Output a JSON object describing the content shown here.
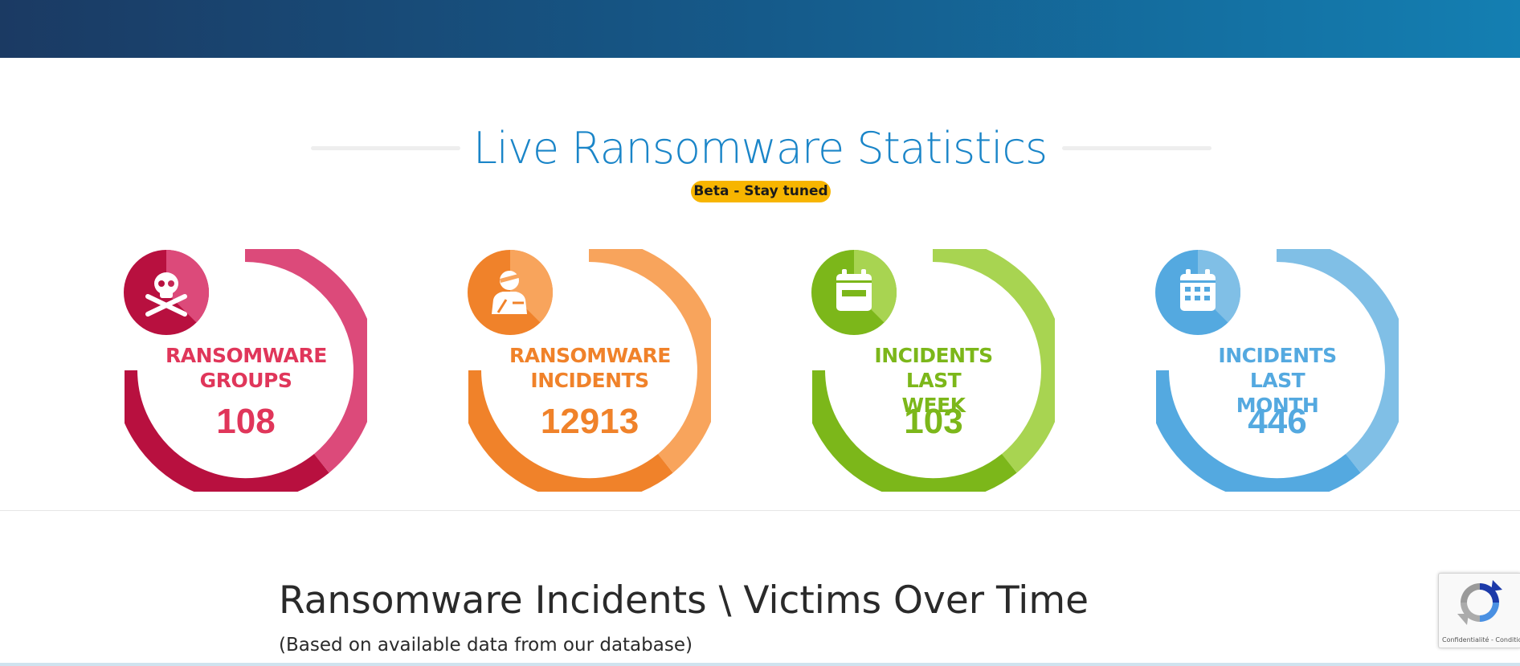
{
  "header": {
    "gradient_start": "#1b3a63",
    "gradient_end": "#147fb2"
  },
  "hero": {
    "title": "Live Ransomware Statistics",
    "badge": "Beta - Stay tuned",
    "title_color": "#1a85c8",
    "badge_color": "#f7b500"
  },
  "stats": [
    {
      "label_line1": "RANSOMWARE",
      "label_line2": "GROUPS",
      "value": "108",
      "icon": "skull-crossbones-icon",
      "color_light": "#dc4a7a",
      "color_dark": "#b8103f",
      "text_color": "#e0365a"
    },
    {
      "label_line1": "RANSOMWARE",
      "label_line2": "INCIDENTS",
      "value": "12913",
      "icon": "injured-person-icon",
      "color_light": "#f8a45c",
      "color_dark": "#f0822a",
      "text_color": "#f0822a"
    },
    {
      "label_line1": "INCIDENTS LAST",
      "label_line2": "WEEK",
      "value": "103",
      "icon": "calendar-week-icon",
      "color_light": "#a8d451",
      "color_dark": "#7cb71a",
      "text_color": "#7cb71a"
    },
    {
      "label_line1": "INCIDENTS LAST",
      "label_line2": "MONTH",
      "value": "446",
      "icon": "calendar-month-icon",
      "color_light": "#80bfe6",
      "color_dark": "#54a9e0",
      "text_color": "#54a9e0"
    }
  ],
  "section": {
    "title": "Ransomware Incidents \\ Victims Over Time",
    "subtitle": "(Based on available data from our database)"
  },
  "recaptcha": {
    "text": "Confidentialité - Conditions",
    "icon": "recaptcha-icon"
  }
}
